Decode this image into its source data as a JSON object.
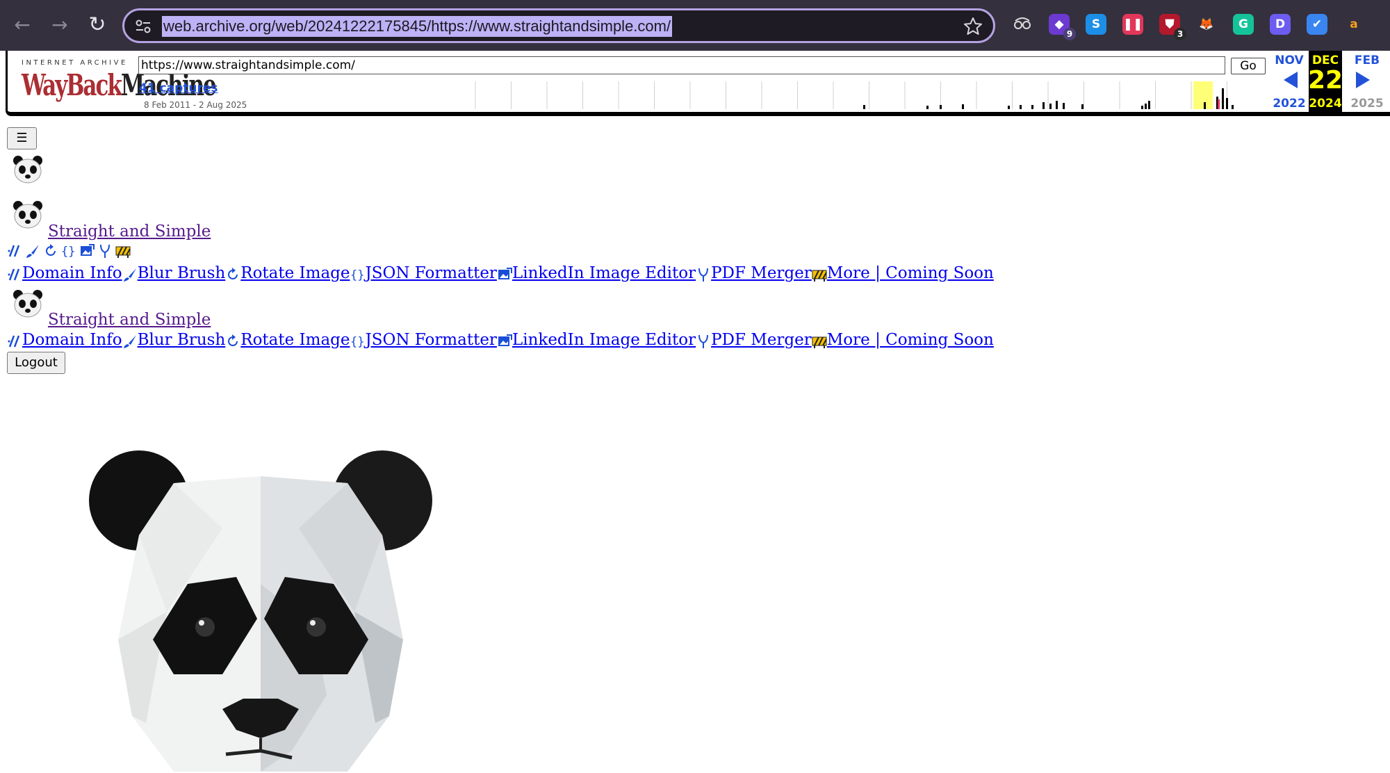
{
  "browser": {
    "url": "web.archive.org/web/20241222175845/https://www.straightandsimple.com/",
    "extensions": [
      {
        "name": "spy-glasses-icon",
        "bg": "#35303e",
        "fg": "#e8e8e8",
        "glyph": "",
        "badge": ""
      },
      {
        "name": "gem-icon",
        "bg": "#6c3ad1",
        "fg": "#ffffff",
        "glyph": "◆",
        "badge": "9"
      },
      {
        "name": "shazam-icon",
        "bg": "#1d8ee6",
        "fg": "#ffffff",
        "glyph": "S",
        "badge": ""
      },
      {
        "name": "pause-block-icon",
        "bg": "#e2375b",
        "fg": "#ffffff",
        "glyph": "❚❚",
        "badge": ""
      },
      {
        "name": "shield-icon",
        "bg": "#b3182c",
        "fg": "#ffffff",
        "glyph": "⛊",
        "badge": "3"
      },
      {
        "name": "metamask-fox-icon",
        "bg": "#35303e",
        "fg": "#f2821e",
        "glyph": "🦊",
        "badge": ""
      },
      {
        "name": "grammarly-icon",
        "bg": "#15c39a",
        "fg": "#ffffff",
        "glyph": "G",
        "badge": ""
      },
      {
        "name": "d-letter-icon",
        "bg": "#6d5cf0",
        "fg": "#ffffff",
        "glyph": "D",
        "badge": ""
      },
      {
        "name": "checkmark-shield-icon",
        "bg": "#3a86f0",
        "fg": "#ffffff",
        "glyph": "✔",
        "badge": ""
      },
      {
        "name": "amazon-icon",
        "bg": "#35303e",
        "fg": "#f6a021",
        "glyph": "a",
        "badge": ""
      }
    ]
  },
  "wayback": {
    "ia_label": "INTERNET ARCHIVE",
    "logo_wayback": "WayBack",
    "logo_machine": "Machine",
    "url_value": "https://www.straightandsimple.com/",
    "go_label": "Go",
    "captures_label": "41 captures",
    "date_range": "8 Feb 2011 - 2 Aug 2025",
    "calendar": {
      "prev_month": "NOV",
      "cur_month": "DEC",
      "next_month": "FEB",
      "cur_day": "22",
      "prev_year": "2022",
      "cur_year": "2024",
      "next_year": "2025"
    },
    "accent_color": "#2252d8",
    "highlight_color": "#ffff00"
  },
  "content": {
    "menu_glyph": "☰",
    "brand_name": "Straight and Simple",
    "nav_items": [
      {
        "label": "Domain Info",
        "icon": "domain-slashes-icon"
      },
      {
        "label": "Blur Brush",
        "icon": "brush-icon"
      },
      {
        "label": "Rotate Image",
        "icon": "rotate-icon"
      },
      {
        "label": "JSON Formatter",
        "icon": "braces-icon"
      },
      {
        "label": "LinkedIn Image Editor",
        "icon": "image-edit-icon"
      },
      {
        "label": "PDF Merger",
        "icon": "merge-icon"
      },
      {
        "label": "More | Coming Soon",
        "icon": "construction-icon"
      }
    ],
    "logout_label": "Logout"
  }
}
